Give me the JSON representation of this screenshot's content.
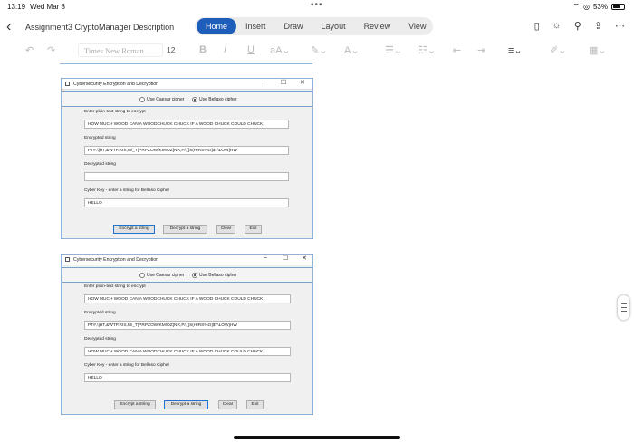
{
  "status": {
    "time": "13:19",
    "date": "Wed Mar 8",
    "battery": "53%"
  },
  "nav": {
    "doc_title": "Assignment3 CryptoManager Description",
    "tabs": [
      {
        "label": "Home",
        "active": true
      },
      {
        "label": "Insert",
        "active": false
      },
      {
        "label": "Draw",
        "active": false
      },
      {
        "label": "Layout",
        "active": false
      },
      {
        "label": "Review",
        "active": false
      },
      {
        "label": "View",
        "active": false
      }
    ]
  },
  "ribbon": {
    "font": "Times New Roman",
    "size": "12"
  },
  "windows": [
    {
      "title": "Cybersecurity Encryption and Decryption",
      "radio_caesar": "Use Caesar cipher",
      "radio_bellaso": "Use Bellaso cipher",
      "plain_label": "Enter plain-text string to encrypt",
      "plain_value": "HOW MUCH WOOD CAN A WOODCHUCK CHUCK IF A WOOD CHUCK COULD CHUCK",
      "enc_label": "Encrypted string",
      "enc_value": "PT#.\\]HT,&WTP.RIS,M/_T[PRPZOW/KM!OZ[NR,P/,([S(H!RS%O]$T\\LOW]HW",
      "dec_label": "Decrypted string",
      "dec_value": "",
      "key_label": "Cyber Key - enter a string for Bellaso Cipher",
      "key_value": "HELLO",
      "buttons": [
        "Encrypt a string",
        "Decrypt a string",
        "Clear",
        "Exit"
      ]
    },
    {
      "title": "Cybersecurity Encryption and Decryption",
      "radio_caesar": "Use Caesar cipher",
      "radio_bellaso": "Use Bellaso cipher",
      "plain_label": "Enter plain-text string to encrypt",
      "plain_value": "HOW MUCH WOOD CAN A WOODCHUCK CHUCK IF A WOOD CHUCK COULD CHUCK",
      "enc_label": "Encrypted string",
      "enc_value": "PT#.\\]HT,&WTP.RIS,M/_T[PRPZOW/KM!OZ[NR,P/,([S(H!RS%O]$T\\LOW]HW",
      "dec_label": "Decrypted string",
      "dec_value": "HOW MUCH WOOD CAN A WOODCHUCK CHUCK IF A WOOD CHUCK COULD CHUCK",
      "key_label": "Cyber Key - enter a string for Bellaso Cipher",
      "key_value": "HELLO",
      "buttons": [
        "Encrypt a string",
        "Decrypt a string",
        "Clear",
        "Exit"
      ]
    }
  ]
}
